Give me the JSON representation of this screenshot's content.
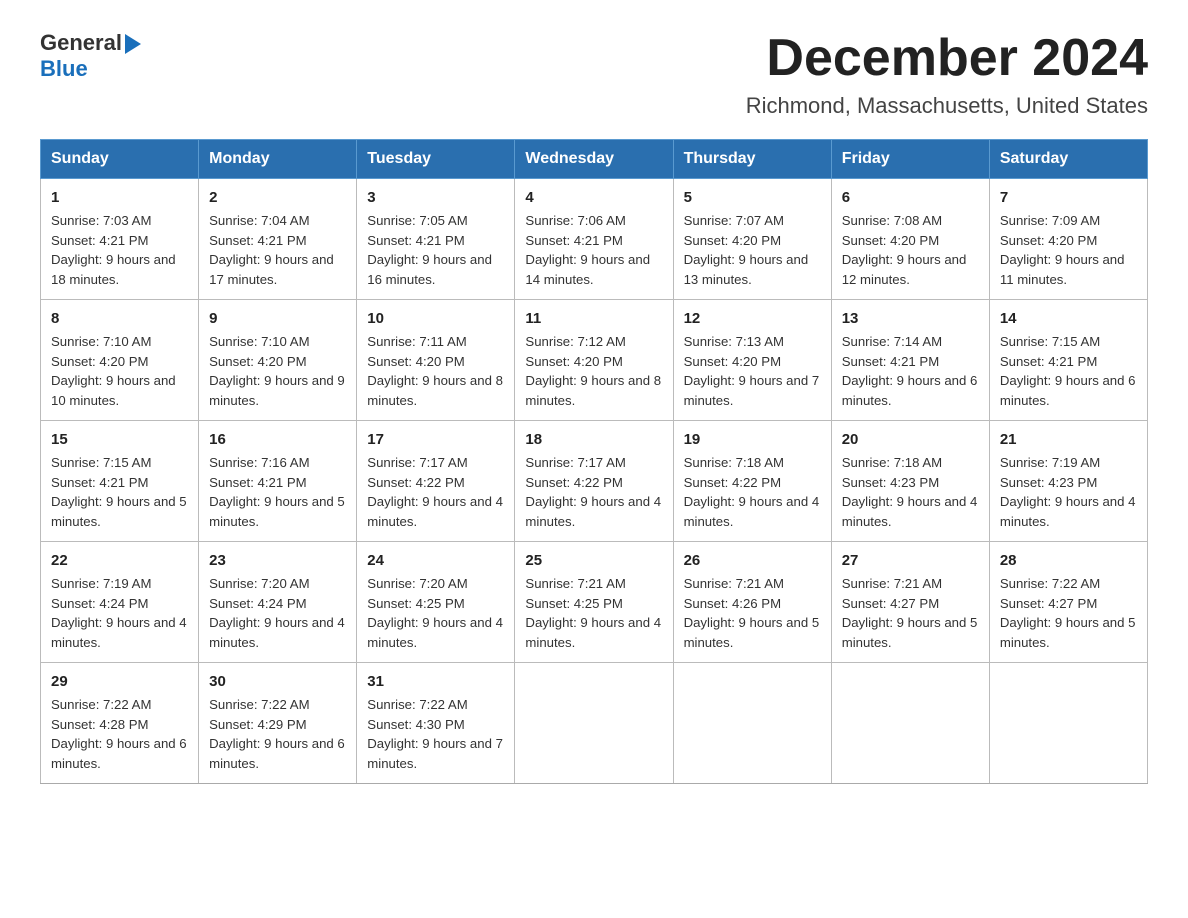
{
  "header": {
    "logo_general": "General",
    "logo_blue": "Blue",
    "title": "December 2024",
    "subtitle": "Richmond, Massachusetts, United States"
  },
  "days_of_week": [
    "Sunday",
    "Monday",
    "Tuesday",
    "Wednesday",
    "Thursday",
    "Friday",
    "Saturday"
  ],
  "weeks": [
    [
      {
        "day": "1",
        "sunrise": "7:03 AM",
        "sunset": "4:21 PM",
        "daylight": "9 hours and 18 minutes."
      },
      {
        "day": "2",
        "sunrise": "7:04 AM",
        "sunset": "4:21 PM",
        "daylight": "9 hours and 17 minutes."
      },
      {
        "day": "3",
        "sunrise": "7:05 AM",
        "sunset": "4:21 PM",
        "daylight": "9 hours and 16 minutes."
      },
      {
        "day": "4",
        "sunrise": "7:06 AM",
        "sunset": "4:21 PM",
        "daylight": "9 hours and 14 minutes."
      },
      {
        "day": "5",
        "sunrise": "7:07 AM",
        "sunset": "4:20 PM",
        "daylight": "9 hours and 13 minutes."
      },
      {
        "day": "6",
        "sunrise": "7:08 AM",
        "sunset": "4:20 PM",
        "daylight": "9 hours and 12 minutes."
      },
      {
        "day": "7",
        "sunrise": "7:09 AM",
        "sunset": "4:20 PM",
        "daylight": "9 hours and 11 minutes."
      }
    ],
    [
      {
        "day": "8",
        "sunrise": "7:10 AM",
        "sunset": "4:20 PM",
        "daylight": "9 hours and 10 minutes."
      },
      {
        "day": "9",
        "sunrise": "7:10 AM",
        "sunset": "4:20 PM",
        "daylight": "9 hours and 9 minutes."
      },
      {
        "day": "10",
        "sunrise": "7:11 AM",
        "sunset": "4:20 PM",
        "daylight": "9 hours and 8 minutes."
      },
      {
        "day": "11",
        "sunrise": "7:12 AM",
        "sunset": "4:20 PM",
        "daylight": "9 hours and 8 minutes."
      },
      {
        "day": "12",
        "sunrise": "7:13 AM",
        "sunset": "4:20 PM",
        "daylight": "9 hours and 7 minutes."
      },
      {
        "day": "13",
        "sunrise": "7:14 AM",
        "sunset": "4:21 PM",
        "daylight": "9 hours and 6 minutes."
      },
      {
        "day": "14",
        "sunrise": "7:15 AM",
        "sunset": "4:21 PM",
        "daylight": "9 hours and 6 minutes."
      }
    ],
    [
      {
        "day": "15",
        "sunrise": "7:15 AM",
        "sunset": "4:21 PM",
        "daylight": "9 hours and 5 minutes."
      },
      {
        "day": "16",
        "sunrise": "7:16 AM",
        "sunset": "4:21 PM",
        "daylight": "9 hours and 5 minutes."
      },
      {
        "day": "17",
        "sunrise": "7:17 AM",
        "sunset": "4:22 PM",
        "daylight": "9 hours and 4 minutes."
      },
      {
        "day": "18",
        "sunrise": "7:17 AM",
        "sunset": "4:22 PM",
        "daylight": "9 hours and 4 minutes."
      },
      {
        "day": "19",
        "sunrise": "7:18 AM",
        "sunset": "4:22 PM",
        "daylight": "9 hours and 4 minutes."
      },
      {
        "day": "20",
        "sunrise": "7:18 AM",
        "sunset": "4:23 PM",
        "daylight": "9 hours and 4 minutes."
      },
      {
        "day": "21",
        "sunrise": "7:19 AM",
        "sunset": "4:23 PM",
        "daylight": "9 hours and 4 minutes."
      }
    ],
    [
      {
        "day": "22",
        "sunrise": "7:19 AM",
        "sunset": "4:24 PM",
        "daylight": "9 hours and 4 minutes."
      },
      {
        "day": "23",
        "sunrise": "7:20 AM",
        "sunset": "4:24 PM",
        "daylight": "9 hours and 4 minutes."
      },
      {
        "day": "24",
        "sunrise": "7:20 AM",
        "sunset": "4:25 PM",
        "daylight": "9 hours and 4 minutes."
      },
      {
        "day": "25",
        "sunrise": "7:21 AM",
        "sunset": "4:25 PM",
        "daylight": "9 hours and 4 minutes."
      },
      {
        "day": "26",
        "sunrise": "7:21 AM",
        "sunset": "4:26 PM",
        "daylight": "9 hours and 5 minutes."
      },
      {
        "day": "27",
        "sunrise": "7:21 AM",
        "sunset": "4:27 PM",
        "daylight": "9 hours and 5 minutes."
      },
      {
        "day": "28",
        "sunrise": "7:22 AM",
        "sunset": "4:27 PM",
        "daylight": "9 hours and 5 minutes."
      }
    ],
    [
      {
        "day": "29",
        "sunrise": "7:22 AM",
        "sunset": "4:28 PM",
        "daylight": "9 hours and 6 minutes."
      },
      {
        "day": "30",
        "sunrise": "7:22 AM",
        "sunset": "4:29 PM",
        "daylight": "9 hours and 6 minutes."
      },
      {
        "day": "31",
        "sunrise": "7:22 AM",
        "sunset": "4:30 PM",
        "daylight": "9 hours and 7 minutes."
      },
      null,
      null,
      null,
      null
    ]
  ]
}
